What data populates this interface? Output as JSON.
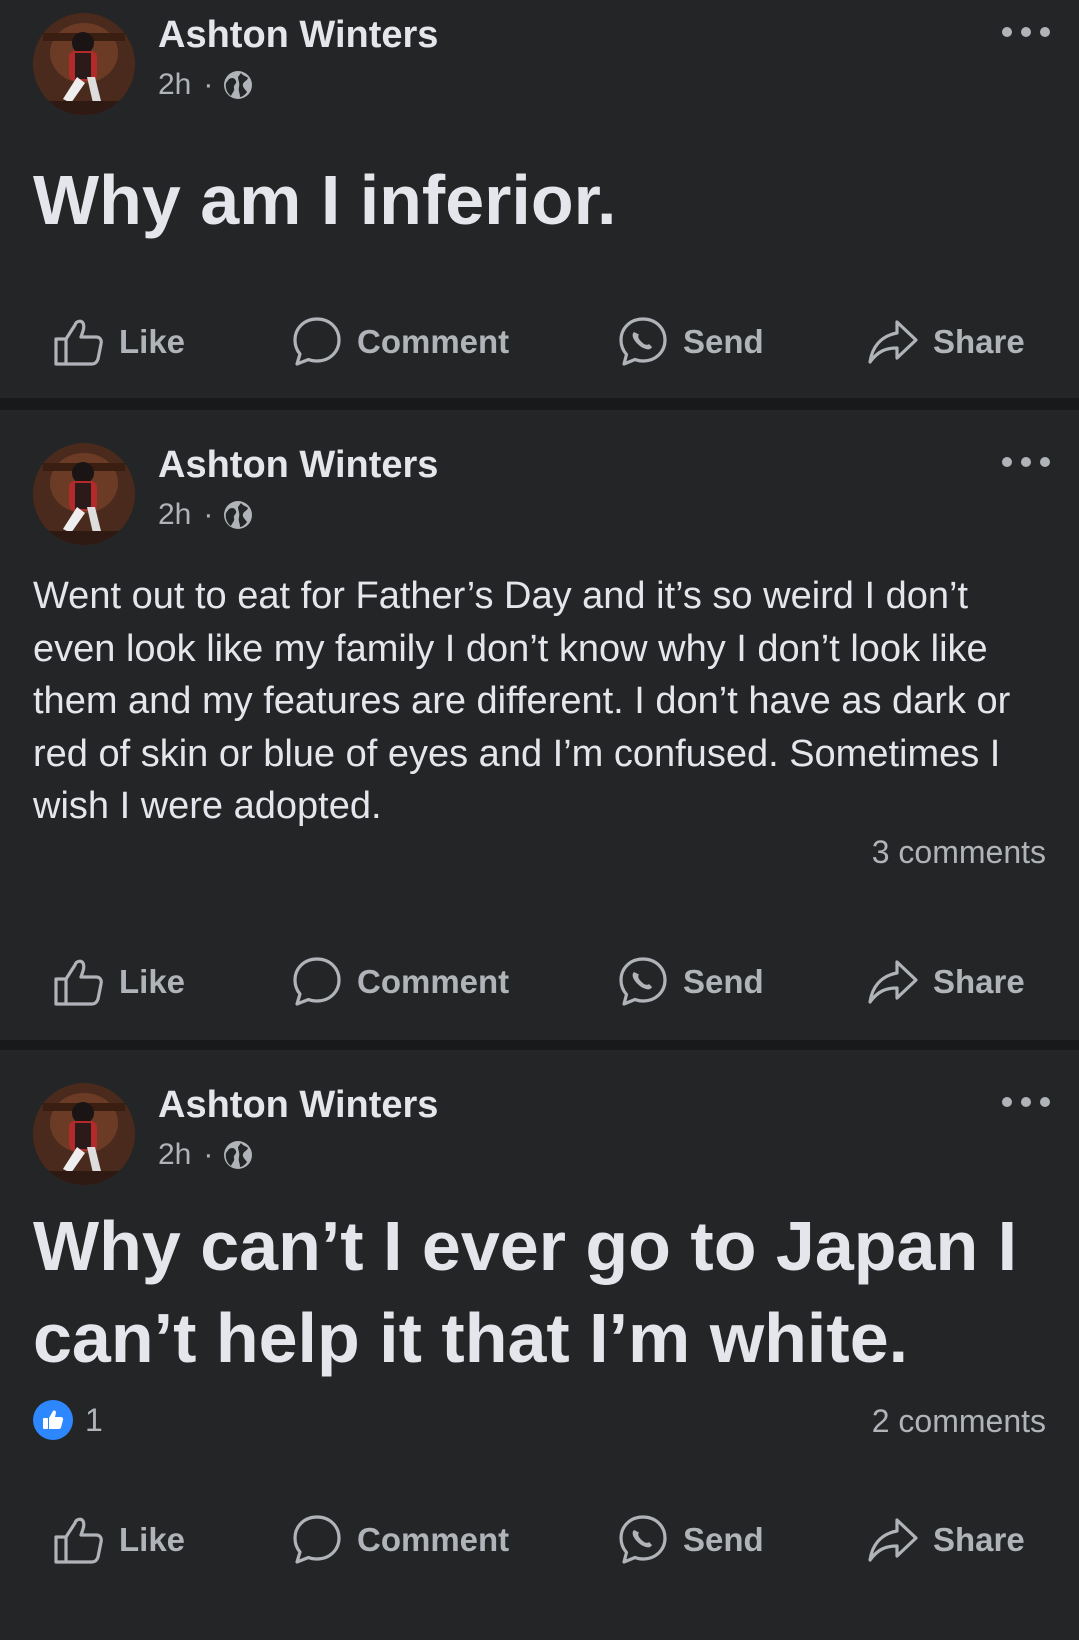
{
  "posts": [
    {
      "author": "Ashton Winters",
      "time": "2h",
      "separator": "·",
      "privacy_icon": "globe-icon",
      "text": "Why am I inferior.",
      "style": "large",
      "reactions_count": "",
      "comments_count": ""
    },
    {
      "author": "Ashton Winters",
      "time": "2h",
      "separator": "·",
      "privacy_icon": "globe-icon",
      "text": "Went out to eat for Father’s Day and it’s so weird I don’t even look like my family I don’t know why I don’t look like them and my features are different.  I don’t have as dark or red of skin or blue of eyes and I’m confused. Sometimes I wish I were adopted.",
      "style": "normal",
      "reactions_count": "",
      "comments_count": "3 comments"
    },
    {
      "author": "Ashton Winters",
      "time": "2h",
      "separator": "·",
      "privacy_icon": "globe-icon",
      "text": "Why can’t I ever go to Japan I can’t help it that I’m white.",
      "style": "large",
      "reactions_count": "1",
      "comments_count": "2 comments"
    }
  ],
  "actions": {
    "like": "Like",
    "comment": "Comment",
    "send": "Send",
    "share": "Share"
  },
  "icons": {
    "like": "thumbs-up-icon",
    "comment": "speech-bubble-icon",
    "send": "messenger-icon",
    "share": "share-arrow-icon",
    "more": "more-dots-icon"
  },
  "colors": {
    "page_bg": "#18191a",
    "card_bg": "#242526",
    "text_primary": "#e4e6eb",
    "text_secondary": "#b0b3b8",
    "like_blue": "#2d88ff"
  }
}
